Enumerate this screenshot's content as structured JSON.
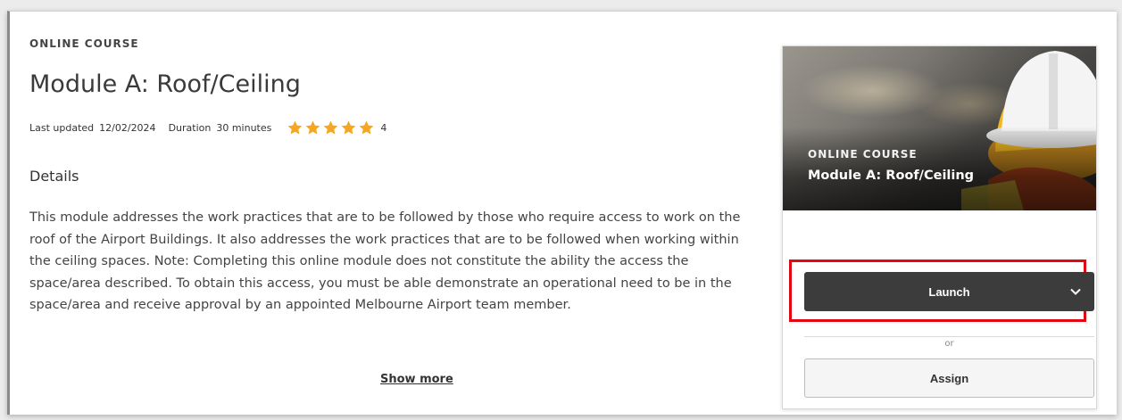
{
  "course": {
    "eyebrow": "ONLINE COURSE",
    "title": "Module A: Roof/Ceiling",
    "last_updated_label": "Last updated",
    "last_updated_value": "12/02/2024",
    "duration_label": "Duration",
    "duration_value": "30 minutes",
    "rating_stars": 5,
    "rating_count": "4",
    "details_heading": "Details",
    "description": "This module addresses the work practices that are to be followed by those who require access to work on the roof of the Airport Buildings. It also addresses the work practices that are to be followed when working within the ceiling spaces. Note: Completing this online module does not constitute the ability the access the space/area described. To obtain this access, you must be able demonstrate an operational need to be in the space/area and receive approval by an appointed Melbourne Airport team member.",
    "show_more_label": "Show more"
  },
  "card": {
    "eyebrow": "ONLINE COURSE",
    "title": "Module A: Roof/Ceiling",
    "launch_label": "Launch",
    "or_label": "or",
    "assign_label": "Assign"
  },
  "colors": {
    "star": "#f5a623",
    "launch_bg": "#3c3c3c",
    "highlight": "#e30613"
  }
}
